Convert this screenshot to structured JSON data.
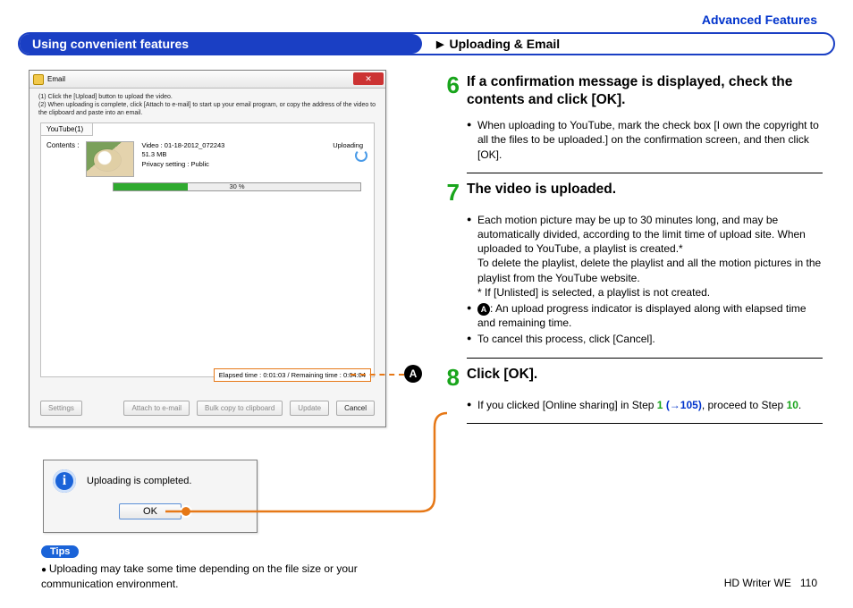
{
  "header": {
    "section": "Advanced Features"
  },
  "titlebar": {
    "left": "Using convenient features",
    "right": "Uploading & Email"
  },
  "screenshot1": {
    "window_title": "Email",
    "close_label": "✕",
    "instr1": "(1)   Click the [Upload] button to upload the video.",
    "instr2": "(2)   When uploading is complete, click [Attach to e-mail] to start up your email program, or copy the address of the video to the clipboard and paste into an email.",
    "tab": "YouTube(1)",
    "contents_label": "Contents :",
    "video_line": "Video : 01-18-2012_072243",
    "size_line": "51.3 MB",
    "privacy_line": "Privacy setting : Public",
    "status": "Uploading",
    "progress_pct": "30 %",
    "time_box": "Elapsed time : 0:01:03 / Remaining time : 0:04:04",
    "btn_settings": "Settings",
    "btn_attach": "Attach to e-mail",
    "btn_bulk": "Bulk copy to clipboard",
    "btn_upload": "Update",
    "btn_cancel": "Cancel"
  },
  "callout_a": "A",
  "screenshot2": {
    "msg": "Uploading is completed.",
    "ok": "OK"
  },
  "tips": {
    "badge": "Tips",
    "text": "Uploading may take some time depending on the file size or your communication environment."
  },
  "steps": {
    "s6": {
      "num": "6",
      "head": "If a confirmation message is displayed, check the contents and click [OK].",
      "b1": "When uploading to YouTube, mark the check box [I own the copyright to all the files to be uploaded.] on the confirmation screen, and then click [OK]."
    },
    "s7": {
      "num": "7",
      "head": "The video is uploaded.",
      "b1": "Each motion picture may be up to 30 minutes long, and may be automatically divided, according to the limit time of upload site. When uploaded to YouTube, a playlist is created.*",
      "b1b": "To delete the playlist, delete the playlist and all the motion pictures in the playlist from the YouTube website.",
      "b1c": "* If [Unlisted] is selected, a playlist is not created.",
      "b2": ": An upload progress indicator is displayed along with elapsed time and remaining time.",
      "b3": "To cancel this process, click [Cancel]."
    },
    "s8": {
      "num": "8",
      "head": "Click [OK].",
      "b1a": "If you clicked [Online sharing] in Step ",
      "b1_step1": "1",
      "b1_link": "(→105)",
      "b1b": ", proceed to Step ",
      "b1_step10": "10",
      "b1c": "."
    }
  },
  "footer": {
    "product": "HD Writer WE",
    "page": "110"
  }
}
